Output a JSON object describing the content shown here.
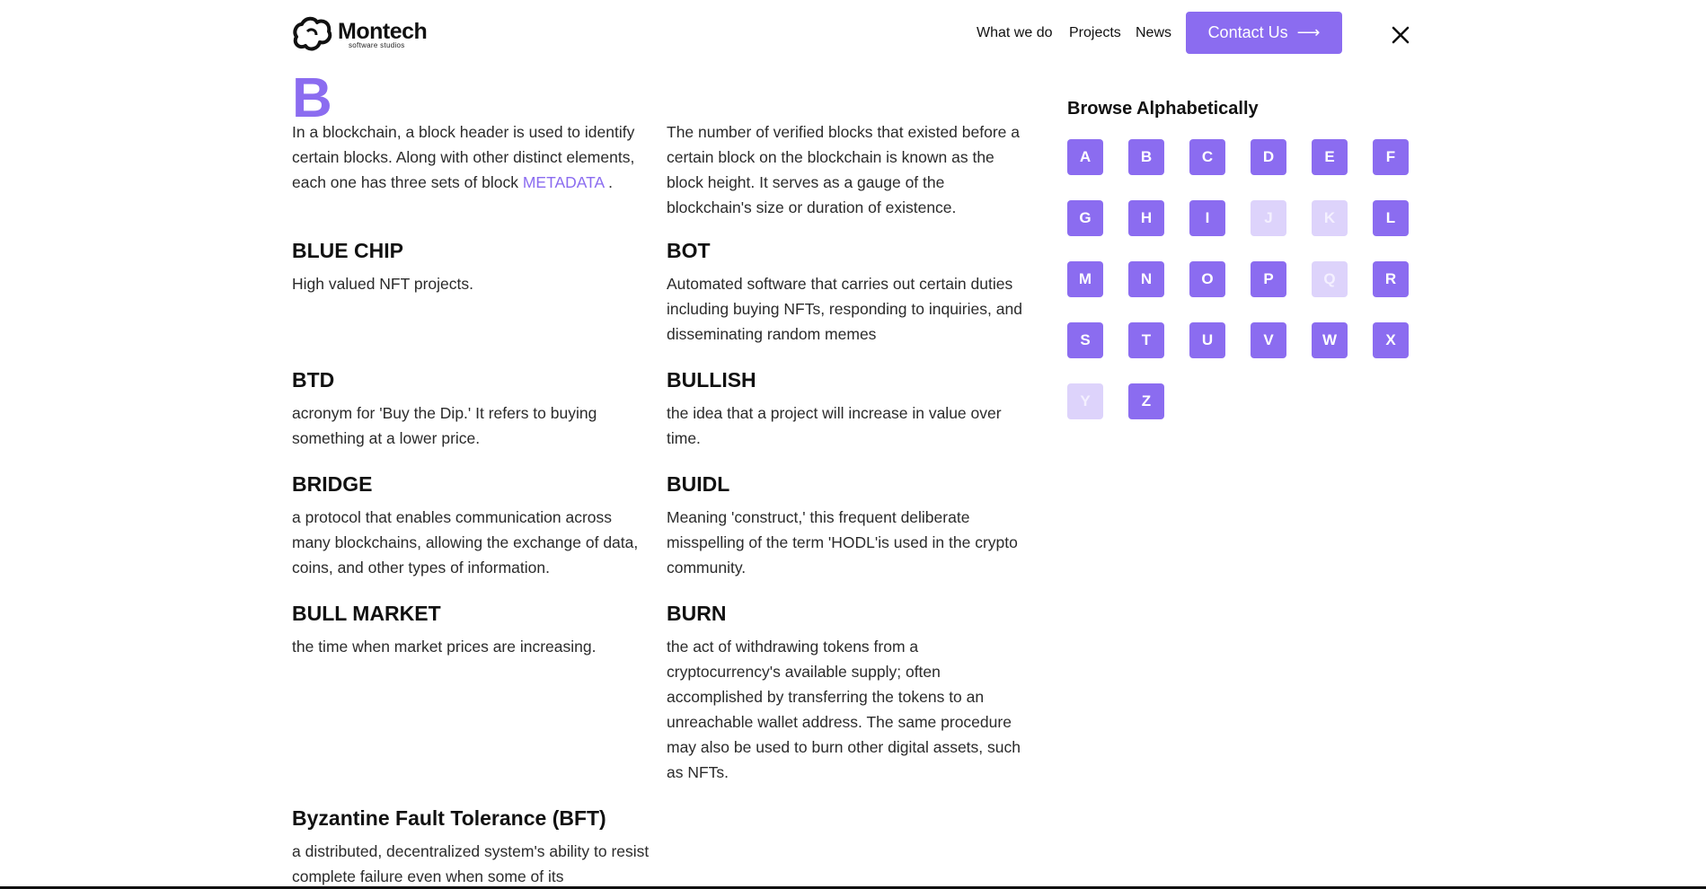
{
  "header": {
    "logo_name": "Montech",
    "logo_sub": "software studios",
    "nav": [
      "What we do",
      "Projects",
      "News"
    ],
    "contact_label": "Contact Us",
    "contact_arrow": "⟶"
  },
  "section": {
    "letter": "B"
  },
  "entries": [
    {
      "term": "",
      "desc_parts": [
        "In a blockchain, a block header is used to identify certain blocks. Along with other distinct elements, each one has three sets of block ",
        "METADATA",
        " ."
      ]
    },
    {
      "term": "",
      "desc": "The number of verified blocks that existed before a certain block on the blockchain is known as the block height. It serves as a gauge of the blockchain's size or duration of existence."
    },
    {
      "term": "BLUE CHIP",
      "desc": "High valued NFT projects."
    },
    {
      "term": "BOT",
      "desc": "Automated software that carries out certain duties including buying NFTs, responding to inquiries, and disseminating random memes"
    },
    {
      "term": "BTD",
      "desc": "acronym for 'Buy the Dip.' It refers to buying something at a lower price."
    },
    {
      "term": "BULLISH",
      "desc": "the idea that a project will increase in value over time."
    },
    {
      "term": "BRIDGE",
      "desc": "a protocol that enables communication across many blockchains, allowing the exchange of data, coins, and other types of information."
    },
    {
      "term": "BUIDL",
      "desc": "Meaning 'construct,' this frequent deliberate misspelling of the term 'HODL'is used in the crypto community."
    },
    {
      "term": "BULL MARKET",
      "desc": "the time when market prices are increasing."
    },
    {
      "term": "BURN",
      "desc": "the act of withdrawing tokens from a cryptocurrency's available supply; often accomplished by transferring the tokens to an unreachable wallet address. The same procedure may also be used to burn other digital assets, such as NFTs."
    },
    {
      "term": "Byzantine Fault Tolerance (BFT)",
      "desc": "a distributed, decentralized system's ability to resist complete failure even when some of its"
    }
  ],
  "sidebar": {
    "title": "Browse Alphabetically",
    "letters": [
      {
        "l": "A",
        "enabled": true
      },
      {
        "l": "B",
        "enabled": true
      },
      {
        "l": "C",
        "enabled": true
      },
      {
        "l": "D",
        "enabled": true
      },
      {
        "l": "E",
        "enabled": true
      },
      {
        "l": "F",
        "enabled": true
      },
      {
        "l": "G",
        "enabled": true
      },
      {
        "l": "H",
        "enabled": true
      },
      {
        "l": "I",
        "enabled": true
      },
      {
        "l": "J",
        "enabled": false
      },
      {
        "l": "K",
        "enabled": false
      },
      {
        "l": "L",
        "enabled": true
      },
      {
        "l": "M",
        "enabled": true
      },
      {
        "l": "N",
        "enabled": true
      },
      {
        "l": "O",
        "enabled": true
      },
      {
        "l": "P",
        "enabled": true
      },
      {
        "l": "Q",
        "enabled": false
      },
      {
        "l": "R",
        "enabled": true
      },
      {
        "l": "S",
        "enabled": true
      },
      {
        "l": "T",
        "enabled": true
      },
      {
        "l": "U",
        "enabled": true
      },
      {
        "l": "V",
        "enabled": true
      },
      {
        "l": "W",
        "enabled": true
      },
      {
        "l": "X",
        "enabled": true
      },
      {
        "l": "Y",
        "enabled": false
      },
      {
        "l": "Z",
        "enabled": true
      }
    ]
  },
  "colors": {
    "accent": "#8b6cf0",
    "disabled": "#ddd3fb"
  }
}
